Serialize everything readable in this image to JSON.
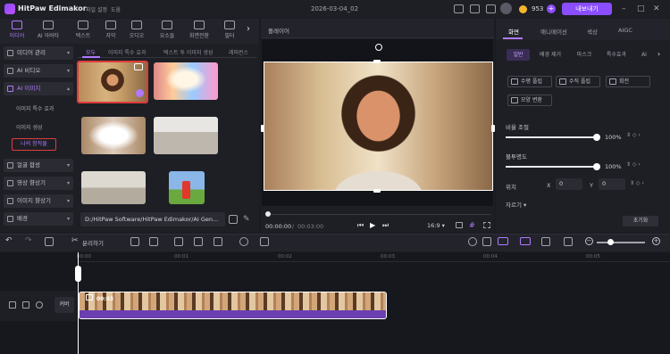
{
  "app": {
    "title": "HitPaw Edimakor",
    "project_title": "2026-03-04_02",
    "coins": "953",
    "export_label": "내보내기"
  },
  "menu": [
    "파일",
    "설정",
    "도움"
  ],
  "categories": [
    {
      "label": "미디어",
      "active": true
    },
    {
      "label": "AI 아바타"
    },
    {
      "label": "텍스트"
    },
    {
      "label": "자막"
    },
    {
      "label": "오디오"
    },
    {
      "label": "요소들"
    },
    {
      "label": "화면전환"
    },
    {
      "label": "필터"
    }
  ],
  "sidebar": {
    "items": [
      {
        "label": "미디어 관리"
      },
      {
        "label": "AI 비디오"
      },
      {
        "label": "AI 이미지"
      },
      {
        "label": "얼굴 합성"
      },
      {
        "label": "영상 향상기"
      },
      {
        "label": "이미지 향상기"
      },
      {
        "label": "배경"
      }
    ],
    "subitems": [
      "이미지 특수 효과",
      "이미지 생성",
      "나의 창작물"
    ]
  },
  "media_tabs": [
    "모두",
    "이미지 특수 효과",
    "텍스트 투 이미지 생성",
    "레퍼런스"
  ],
  "media_path": "D:/HitPaw Software/HitPaw Edimakor/AI Gen...",
  "player": {
    "title": "플레이어",
    "current_time": "00:00:00",
    "total_time": "00:03:00",
    "aspect_ratio": "16:9"
  },
  "right_panel": {
    "tabs": [
      "화면",
      "애니메이션",
      "색상",
      "AIGC"
    ],
    "sub_tabs": [
      "일반",
      "배경 제거",
      "마스크",
      "특수효과",
      "AI"
    ],
    "buttons": [
      "수평 플립",
      "수직 플립",
      "회전",
      "모양 변환"
    ],
    "opacity_label": "비율 조절",
    "opacity_value": "100%",
    "opacity_level": 1.0,
    "blur_label": "불투명도",
    "blur_value": "100%",
    "blur_level": 1.0,
    "position_label": "위치",
    "x_label": "X",
    "x_value": "0",
    "y_label": "Y",
    "y_value": "0",
    "more_label": "자르기 ▾",
    "reset_label": "초기화"
  },
  "timeline": {
    "split_label": "분리하기",
    "ruler": [
      "00:00",
      "00:01",
      "00:02",
      "00:03",
      "00:04",
      "00:05"
    ],
    "cover_label": "커버",
    "clip_label": "00:03"
  },
  "colors": {
    "accent": "#8a4dff",
    "highlight": "#e03b3b"
  }
}
